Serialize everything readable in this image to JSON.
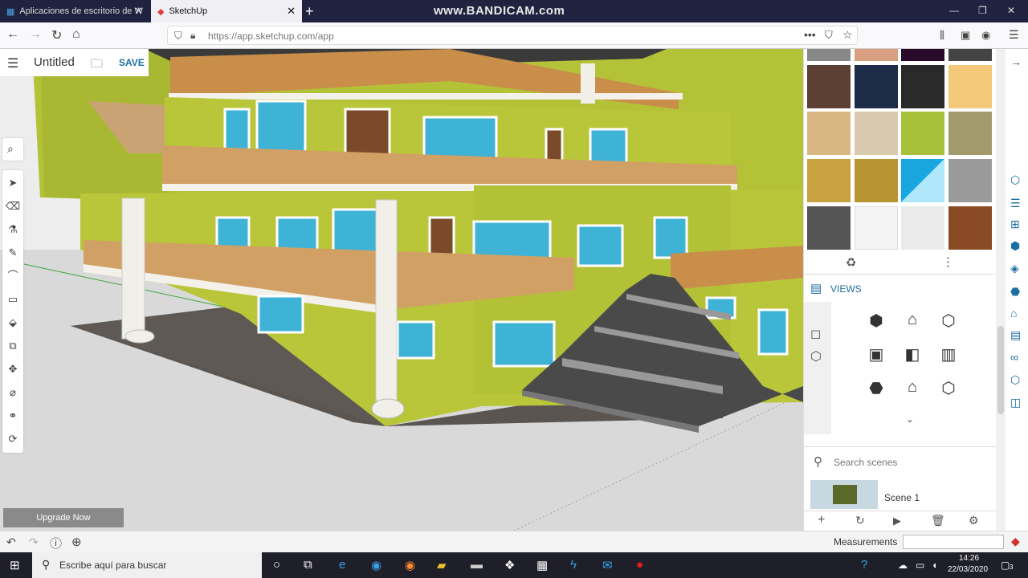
{
  "browser": {
    "tabs": [
      {
        "label": "Aplicaciones de escritorio de W"
      },
      {
        "label": "SketchUp"
      }
    ],
    "url": "https://app.sketchup.com/app",
    "watermark": "www.BANDICAM.com"
  },
  "app": {
    "title": "Untitled",
    "save_label": "SAVE",
    "upgrade_label": "Upgrade Now"
  },
  "panel": {
    "views_label": "VIEWS",
    "search_placeholder": "Search scenes",
    "scene_name": "Scene 1"
  },
  "status": {
    "measurements_label": "Measurements"
  },
  "taskbar": {
    "search_placeholder": "Escribe aquí para buscar",
    "time": "14:26",
    "date": "22/03/2020",
    "notification_count": "3"
  },
  "colors": {
    "accent": "#1a6fa0",
    "wall": "#b9c639",
    "window": "#3fb3d6"
  }
}
